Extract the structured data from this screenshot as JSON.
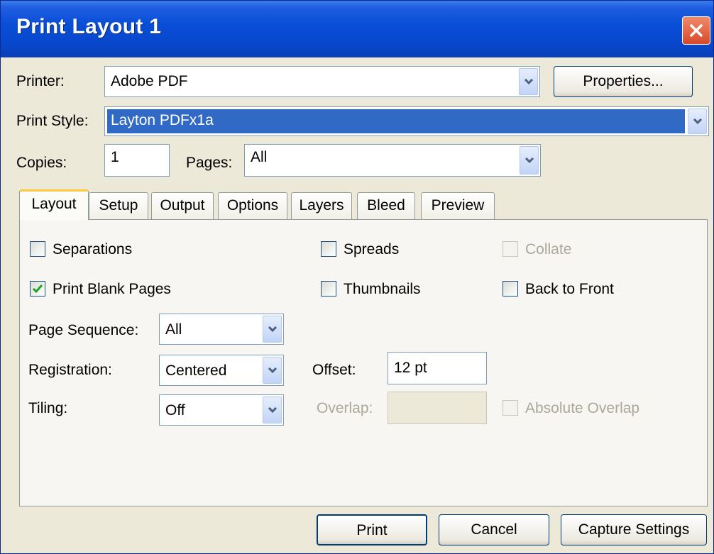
{
  "window": {
    "title": "Print Layout 1"
  },
  "printer": {
    "label": "Printer:",
    "value": "Adobe PDF",
    "properties_button": "Properties..."
  },
  "print_style": {
    "label": "Print Style:",
    "value": "Layton PDFx1a"
  },
  "copies": {
    "label": "Copies:",
    "value": "1"
  },
  "pages": {
    "label": "Pages:",
    "value": "All"
  },
  "tabs": [
    {
      "label": "Layout"
    },
    {
      "label": "Setup"
    },
    {
      "label": "Output"
    },
    {
      "label": "Options"
    },
    {
      "label": "Layers"
    },
    {
      "label": "Bleed"
    },
    {
      "label": "Preview"
    }
  ],
  "layout": {
    "separations": {
      "label": "Separations",
      "checked": false
    },
    "spreads": {
      "label": "Spreads",
      "checked": false
    },
    "collate": {
      "label": "Collate",
      "checked": false,
      "enabled": false
    },
    "print_blank_pages": {
      "label": "Print Blank Pages",
      "checked": true
    },
    "thumbnails": {
      "label": "Thumbnails",
      "checked": false
    },
    "back_to_front": {
      "label": "Back to Front",
      "checked": false
    },
    "page_sequence": {
      "label": "Page Sequence:",
      "value": "All"
    },
    "registration": {
      "label": "Registration:",
      "value": "Centered"
    },
    "offset": {
      "label": "Offset:",
      "value": "12 pt"
    },
    "tiling": {
      "label": "Tiling:",
      "value": "Off"
    },
    "overlap": {
      "label": "Overlap:",
      "value": "",
      "enabled": false
    },
    "absolute_overlap": {
      "label": "Absolute Overlap",
      "checked": false,
      "enabled": false
    }
  },
  "buttons": {
    "print": "Print",
    "cancel": "Cancel",
    "capture_settings": "Capture Settings"
  },
  "colors": {
    "titlebar": "#0747cc",
    "selection": "#316ac5",
    "face": "#ece9d8",
    "close": "#d8482a"
  }
}
